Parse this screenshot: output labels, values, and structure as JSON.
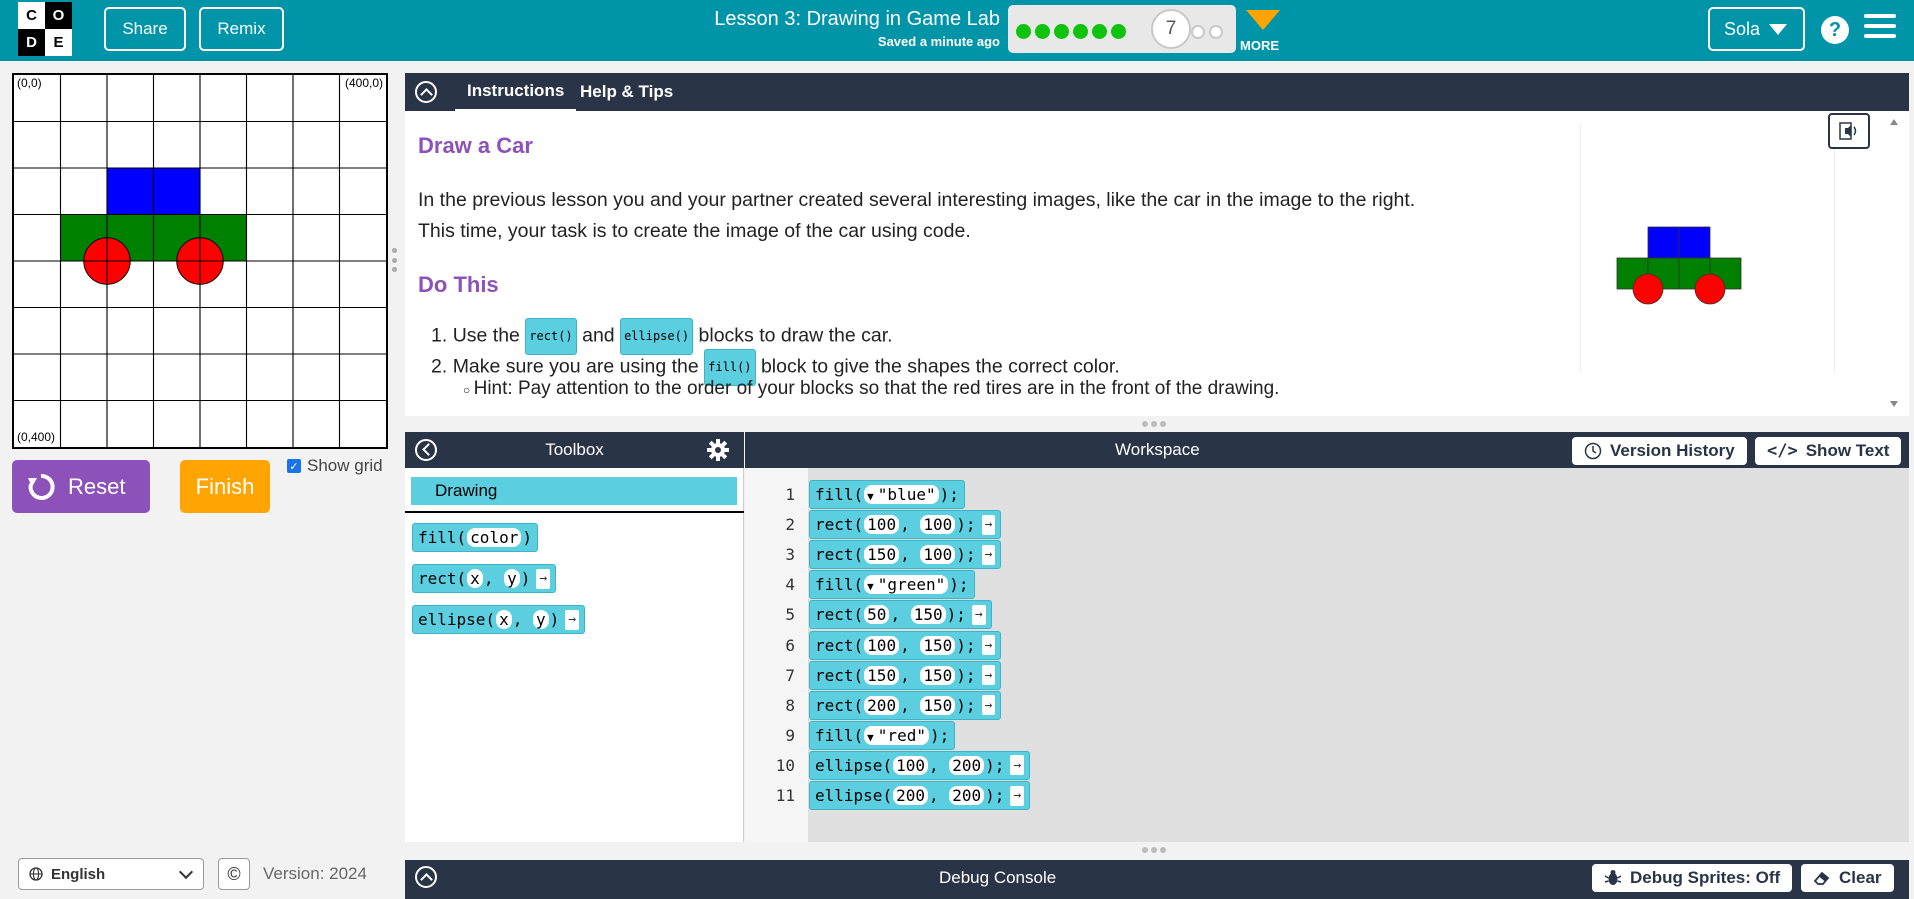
{
  "header": {
    "logo_letters": [
      "C",
      "O",
      "D",
      "E"
    ],
    "share_label": "Share",
    "remix_label": "Remix",
    "lesson_title": "Lesson 3: Drawing in Game Lab",
    "saved_status": "Saved a minute ago",
    "progress": {
      "completed_levels": 6,
      "current_level": "7",
      "remaining_levels": 2
    },
    "more_label": "MORE",
    "user_name": "Sola",
    "help_label": "?"
  },
  "canvas": {
    "top_left_label": "(0,0)",
    "top_right_label": "(400,0)",
    "bottom_left_label": "(0,400)",
    "colors": {
      "body_top": "#0000ff",
      "body_bottom": "#008000",
      "wheel": "#ff0000"
    }
  },
  "controls": {
    "reset_label": "Reset",
    "finish_label": "Finish",
    "show_grid_label": "Show grid",
    "show_grid_checked": true
  },
  "footer": {
    "language": "English",
    "copyright_icon": "©",
    "version_label": "Version: 2024"
  },
  "instructions": {
    "tabs": [
      {
        "label": "Instructions",
        "active": true
      },
      {
        "label": "Help & Tips",
        "active": false
      }
    ],
    "heading1": "Draw a Car",
    "intro_line1": "In the previous lesson you and your partner created several interesting images, like the car in the image to the right.",
    "intro_line2": "This time, your task is to create the image of the car using code.",
    "heading2": "Do This",
    "step1_pre": "Use the",
    "step1_chip1": "rect()",
    "step1_mid": "and",
    "step1_chip2": "ellipse()",
    "step1_post": "blocks to draw the car.",
    "step2_pre": "Make sure you are using the",
    "step2_chip": "fill()",
    "step2_post": "block to give the shapes the correct color.",
    "hint": "Hint: Pay attention to the order of your blocks so that the red tires are in the front of the drawing."
  },
  "toolbox": {
    "title": "Toolbox",
    "category": "Drawing",
    "blocks": [
      {
        "name": "fill",
        "args": [
          "color"
        ],
        "has_arrow": false
      },
      {
        "name": "rect",
        "args": [
          "x",
          "y"
        ],
        "has_arrow": true
      },
      {
        "name": "ellipse",
        "args": [
          "x",
          "y"
        ],
        "has_arrow": true
      }
    ]
  },
  "workspace": {
    "title": "Workspace",
    "version_history_label": "Version History",
    "show_text_label": "Show Text",
    "lines": [
      {
        "num": "1",
        "fn": "fill",
        "args": [
          "\"blue\""
        ],
        "dropdown": true,
        "arrow": false
      },
      {
        "num": "2",
        "fn": "rect",
        "args": [
          "100",
          "100"
        ],
        "dropdown": false,
        "arrow": true
      },
      {
        "num": "3",
        "fn": "rect",
        "args": [
          "150",
          "100"
        ],
        "dropdown": false,
        "arrow": true
      },
      {
        "num": "4",
        "fn": "fill",
        "args": [
          "\"green\""
        ],
        "dropdown": true,
        "arrow": false
      },
      {
        "num": "5",
        "fn": "rect",
        "args": [
          "50",
          "150"
        ],
        "dropdown": false,
        "arrow": true
      },
      {
        "num": "6",
        "fn": "rect",
        "args": [
          "100",
          "150"
        ],
        "dropdown": false,
        "arrow": true
      },
      {
        "num": "7",
        "fn": "rect",
        "args": [
          "150",
          "150"
        ],
        "dropdown": false,
        "arrow": true
      },
      {
        "num": "8",
        "fn": "rect",
        "args": [
          "200",
          "150"
        ],
        "dropdown": false,
        "arrow": true
      },
      {
        "num": "9",
        "fn": "fill",
        "args": [
          "\"red\""
        ],
        "dropdown": true,
        "arrow": false
      },
      {
        "num": "10",
        "fn": "ellipse",
        "args": [
          "100",
          "200"
        ],
        "dropdown": false,
        "arrow": true
      },
      {
        "num": "11",
        "fn": "ellipse",
        "args": [
          "200",
          "200"
        ],
        "dropdown": false,
        "arrow": true
      }
    ]
  },
  "console": {
    "title": "Debug Console",
    "debug_sprites_label": "Debug Sprites: Off",
    "clear_label": "Clear"
  },
  "theme": {
    "header_bg": "#0094a8",
    "dark_bar": "#293546",
    "block_color": "#5bcfe0",
    "accent_purple": "#8c52ba",
    "accent_orange": "#ffa400",
    "progress_green": "#0ec20e"
  }
}
